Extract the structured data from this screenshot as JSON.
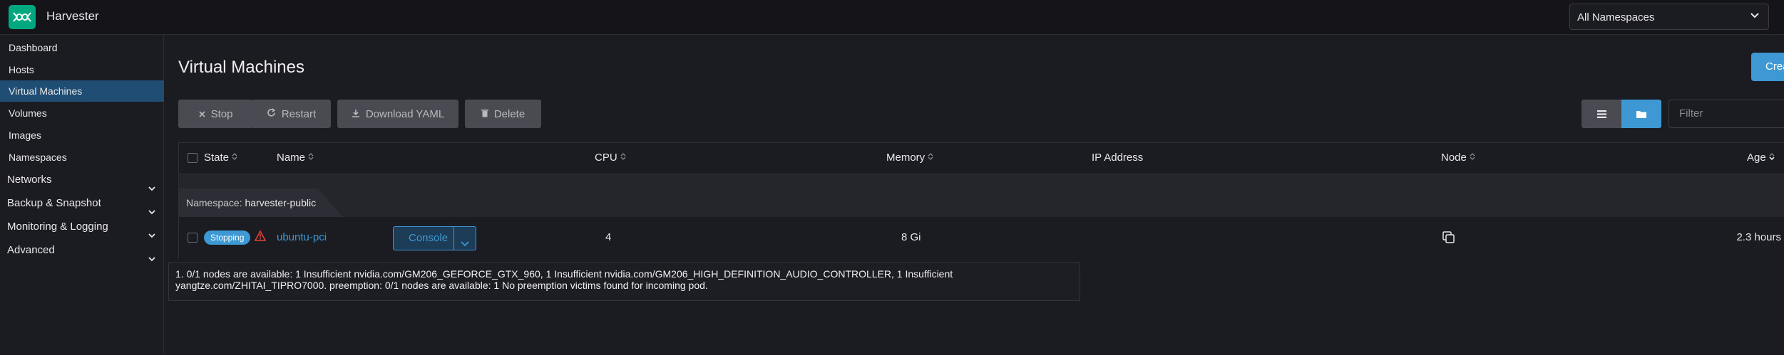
{
  "app": {
    "title": "Harvester"
  },
  "namespace_select": {
    "value": "All Namespaces"
  },
  "sidebar": {
    "items": [
      {
        "label": "Dashboard"
      },
      {
        "label": "Hosts"
      },
      {
        "label": "Virtual Machines",
        "active": true
      },
      {
        "label": "Volumes"
      },
      {
        "label": "Images"
      },
      {
        "label": "Namespaces"
      }
    ],
    "groups": [
      {
        "label": "Networks"
      },
      {
        "label": "Backup & Snapshot"
      },
      {
        "label": "Monitoring & Logging"
      },
      {
        "label": "Advanced"
      }
    ]
  },
  "page": {
    "title": "Virtual Machines",
    "create_label": "Create"
  },
  "toolbar": {
    "stop_label": "Stop",
    "restart_label": "Restart",
    "download_label": "Download YAML",
    "delete_label": "Delete",
    "filter_placeholder": "Filter"
  },
  "table": {
    "columns": [
      "State",
      "Name",
      "CPU",
      "Memory",
      "IP Address",
      "Node",
      "Age"
    ],
    "group": {
      "prefix": "Namespace:",
      "name": "harvester-public"
    },
    "rows": [
      {
        "state": "Stopping",
        "name": "ubuntu-pci",
        "action": "Console",
        "cpu": "4",
        "memory": "8 Gi",
        "ip": "",
        "age": "2.3 hours"
      }
    ]
  },
  "tooltip": {
    "line1": "1. 0/1 nodes are available: 1 Insufficient nvidia.com/GM206_GEFORCE_GTX_960, 1 Insufficient nvidia.com/GM206_HIGH_DEFINITION_AUDIO_CONTROLLER, 1 Insufficient",
    "line2": "yangtze.com/ZHITAI_TIPRO7000. preemption: 0/1 nodes are available: 1 No preemption victims found for incoming pod."
  },
  "colors": {
    "accent": "#3d98d3",
    "active_nav": "#1f4d73",
    "logo": "#00a880",
    "warning": "#e0413a"
  }
}
